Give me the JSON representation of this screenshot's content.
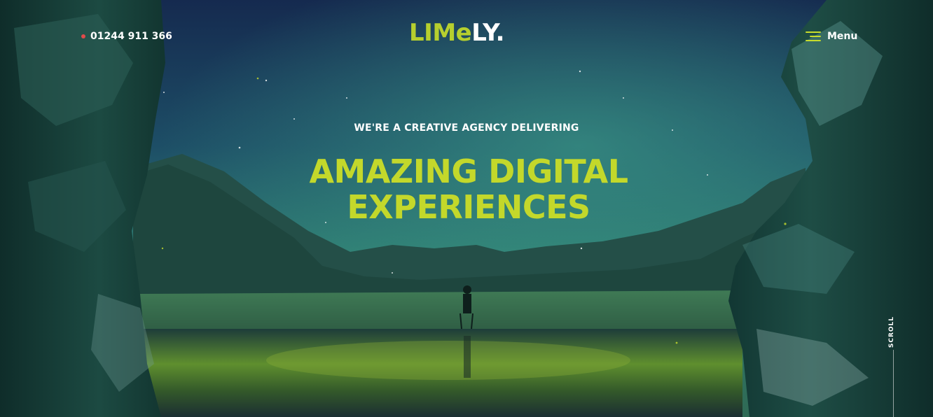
{
  "header": {
    "phone": "01244 911 366",
    "logo": {
      "lime": "LIMe",
      "ly": "LY."
    },
    "menu_label": "Menu"
  },
  "hero": {
    "tagline": "WE'RE A CREATIVE AGENCY DELIVERING",
    "headline_line1": "AMAZING DIGITAL",
    "headline_line2": "EXPERIENCES",
    "scroll_label": "SCROLL"
  },
  "colors": {
    "accent": "#c3d82b",
    "text": "#ffffff",
    "phone_dot": "#e04a4a"
  },
  "icons": {
    "phone": "phone-dot-icon",
    "menu": "hamburger-menu-icon"
  }
}
